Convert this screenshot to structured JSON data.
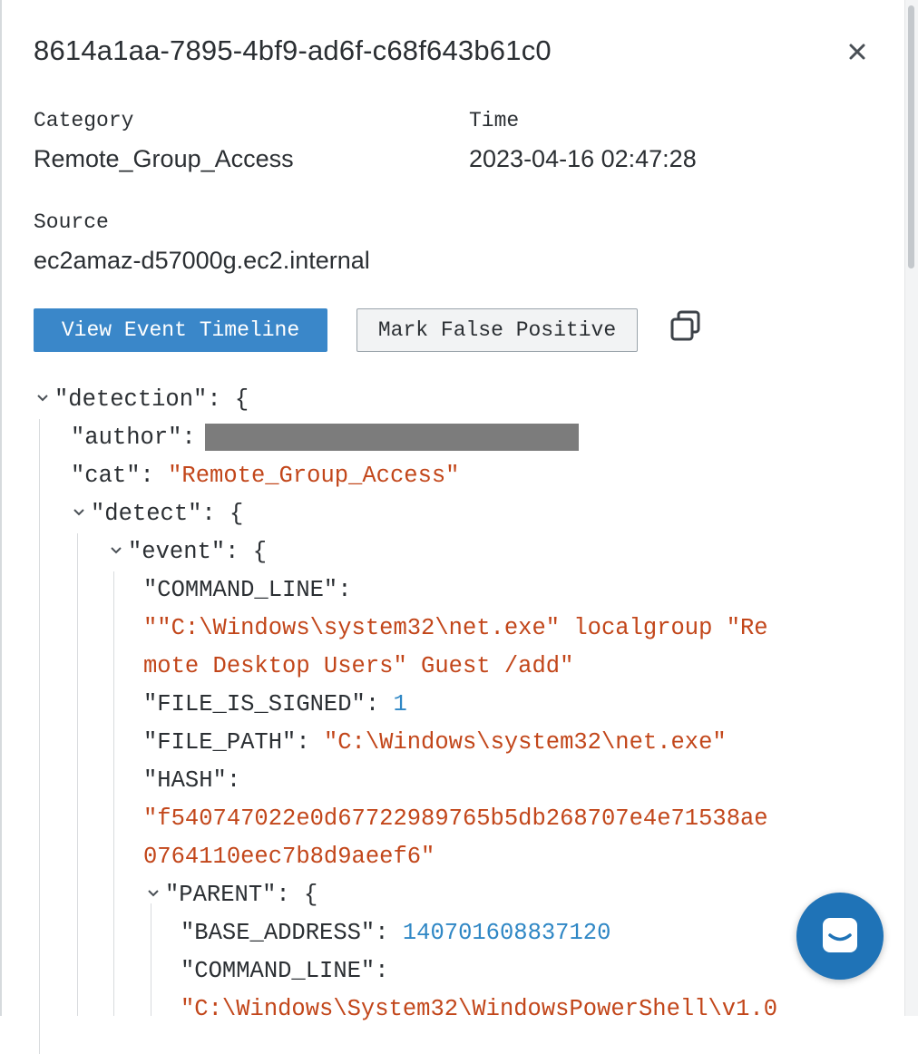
{
  "header": {
    "title": "8614a1aa-7895-4bf9-ad6f-c68f643b61c0",
    "close_icon": "close-icon"
  },
  "fields": {
    "category_label": "Category",
    "category_value": "Remote_Group_Access",
    "time_label": "Time",
    "time_value": "2023-04-16 02:47:28",
    "source_label": "Source",
    "source_value": "ec2amaz-d57000g.ec2.internal"
  },
  "actions": {
    "view_timeline_label": "View Event Timeline",
    "mark_false_positive_label": "Mark False Positive",
    "copy_icon": "copy-icon"
  },
  "json_view": {
    "detection_key": "\"detection\"",
    "author_key": "\"author\"",
    "cat_key": "\"cat\"",
    "cat_value": "\"Remote_Group_Access\"",
    "detect_key": "\"detect\"",
    "event_key": "\"event\"",
    "command_line_key": "\"COMMAND_LINE\"",
    "command_line_value_line1": "\"\"C:\\Windows\\system32\\net.exe\" localgroup \"Re",
    "command_line_value_line2": "mote Desktop Users\" Guest /add\"",
    "file_is_signed_key": "\"FILE_IS_SIGNED\"",
    "file_is_signed_value": "1",
    "file_path_key": "\"FILE_PATH\"",
    "file_path_value": "\"C:\\Windows\\system32\\net.exe\"",
    "hash_key": "\"HASH\"",
    "hash_value_line1": "\"f540747022e0d67722989765b5db268707e4e71538ae",
    "hash_value_line2": "0764110eec7b8d9aeef6\"",
    "parent_key": "\"PARENT\"",
    "base_address_key": "\"BASE_ADDRESS\"",
    "base_address_value": "140701608837120",
    "parent_command_line_key": "\"COMMAND_LINE\"",
    "parent_command_line_value_line1": "\"C:\\Windows\\System32\\WindowsPowerShell\\v1.0"
  },
  "colors": {
    "accent": "#3a87c9",
    "string": "#c2461a",
    "number": "#2f87c5",
    "chat": "#1f73b7"
  },
  "chat": {
    "icon": "chat-icon"
  }
}
